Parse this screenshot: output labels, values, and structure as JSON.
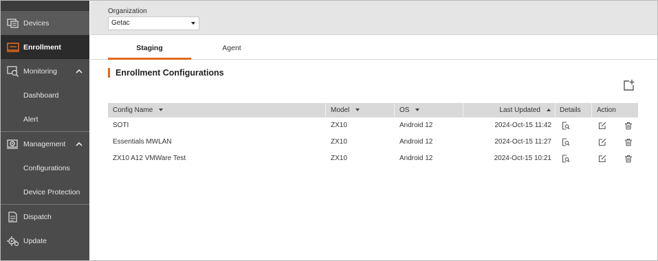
{
  "sidebar": {
    "items": [
      {
        "label": "Devices",
        "icon": "devices-icon"
      },
      {
        "label": "Enrollment",
        "icon": "enrollment-icon"
      },
      {
        "label": "Monitoring",
        "icon": "monitoring-icon"
      },
      {
        "label": "Dashboard"
      },
      {
        "label": "Alert"
      },
      {
        "label": "Management",
        "icon": "management-icon"
      },
      {
        "label": "Configurations"
      },
      {
        "label": "Device Protection"
      },
      {
        "label": "Dispatch",
        "icon": "dispatch-icon"
      },
      {
        "label": "Update",
        "icon": "update-icon"
      }
    ]
  },
  "org": {
    "label": "Organization",
    "selected": "Getac"
  },
  "tabs": [
    {
      "label": "Staging",
      "active": true
    },
    {
      "label": "Agent",
      "active": false
    }
  ],
  "section": {
    "title": "Enrollment Configurations"
  },
  "table": {
    "headers": {
      "config_name": "Config Name",
      "model": "Model",
      "os": "OS",
      "last_updated": "Last Updated",
      "details": "Details",
      "action": "Action"
    },
    "rows": [
      {
        "config_name": "SOTI",
        "model": "ZX10",
        "os": "Android 12",
        "last_updated": "2024-Oct-15 11:42"
      },
      {
        "config_name": "Essentials MWLAN",
        "model": "ZX10",
        "os": "Android 12",
        "last_updated": "2024-Oct-15 11:27"
      },
      {
        "config_name": "ZX10 A12 VMWare Test",
        "model": "ZX10",
        "os": "Android 12",
        "last_updated": "2024-Oct-15 10:21"
      }
    ]
  },
  "colors": {
    "accent": "#e06a1b",
    "sidebar_bg": "#4b4b4b",
    "sidebar_active": "#2b2b2b",
    "header_bg": "#d9d9d9"
  }
}
